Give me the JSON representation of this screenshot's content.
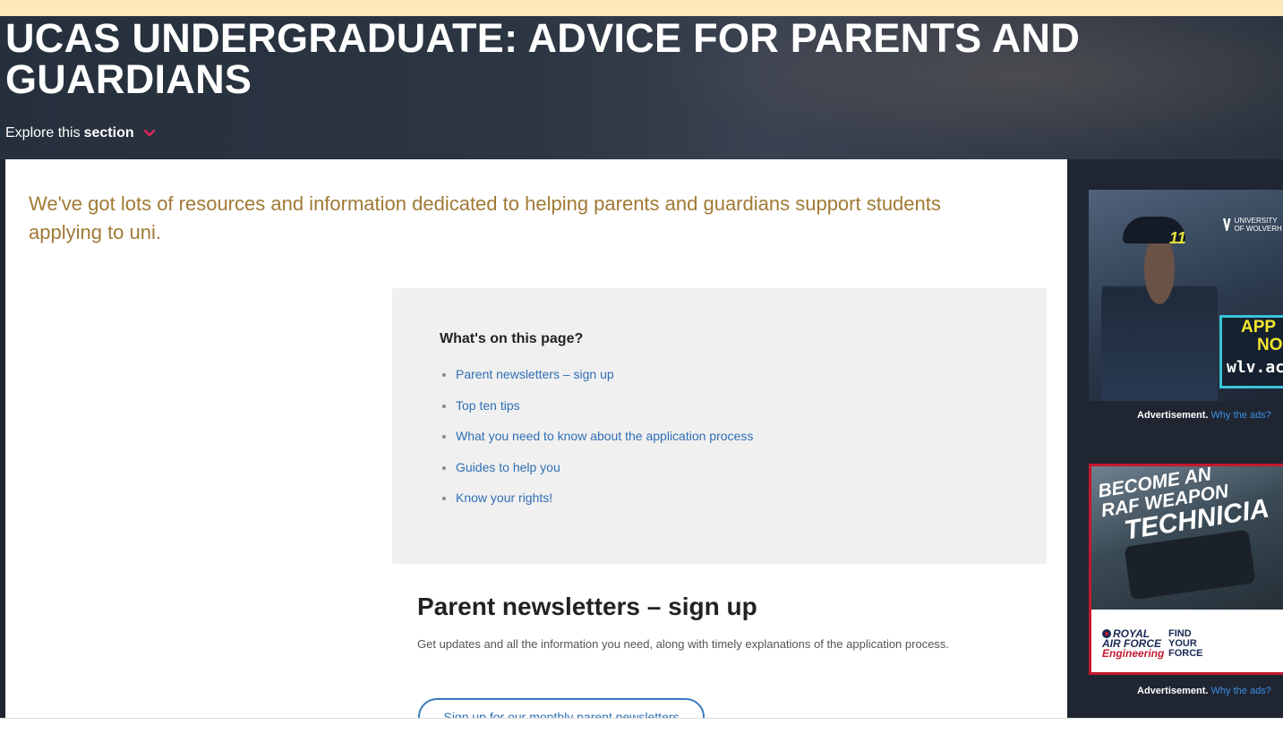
{
  "hero": {
    "title": "UCAS UNDERGRADUATE: ADVICE FOR PARENTS AND GUARDIANS",
    "explore_prefix": "Explore this",
    "explore_bold": "section"
  },
  "intro": "We've got lots of resources and information dedicated to helping parents and guardians support students applying to uni.",
  "toc": {
    "title": "What's on this page?",
    "items": [
      "Parent newsletters – sign up",
      "Top ten tips",
      "What you need to know about the application process",
      "Guides to help you",
      "Know your rights!"
    ]
  },
  "section": {
    "heading": "Parent newsletters – sign up",
    "body": "Get updates and all the information you need, along with timely explanations of the application process.",
    "button": "Sign up for our monthly parent newsletters"
  },
  "ads": {
    "ad1": {
      "cap_number": "11",
      "logo_text": "UNIVERSITY OF WOLVERH",
      "apply": "APP",
      "now": "NO",
      "url": "wlv.ac"
    },
    "ad2": {
      "headline_1": "BECOME AN",
      "headline_2": "RAF WEAPON",
      "headline_3": "TECHNICIA",
      "raf_1": "ROYAL",
      "raf_2": "AIR FORCE",
      "raf_3": "Engineering",
      "fyf_1": "FIND",
      "fyf_2": "YOUR",
      "fyf_3": "FORCE"
    },
    "label": "Advertisement.",
    "why": "Why the ads?"
  },
  "colors": {
    "accent": "#e5235b",
    "intro_text": "#a07a35",
    "link": "#2f6fb5",
    "dark_bg": "#1f2632"
  }
}
